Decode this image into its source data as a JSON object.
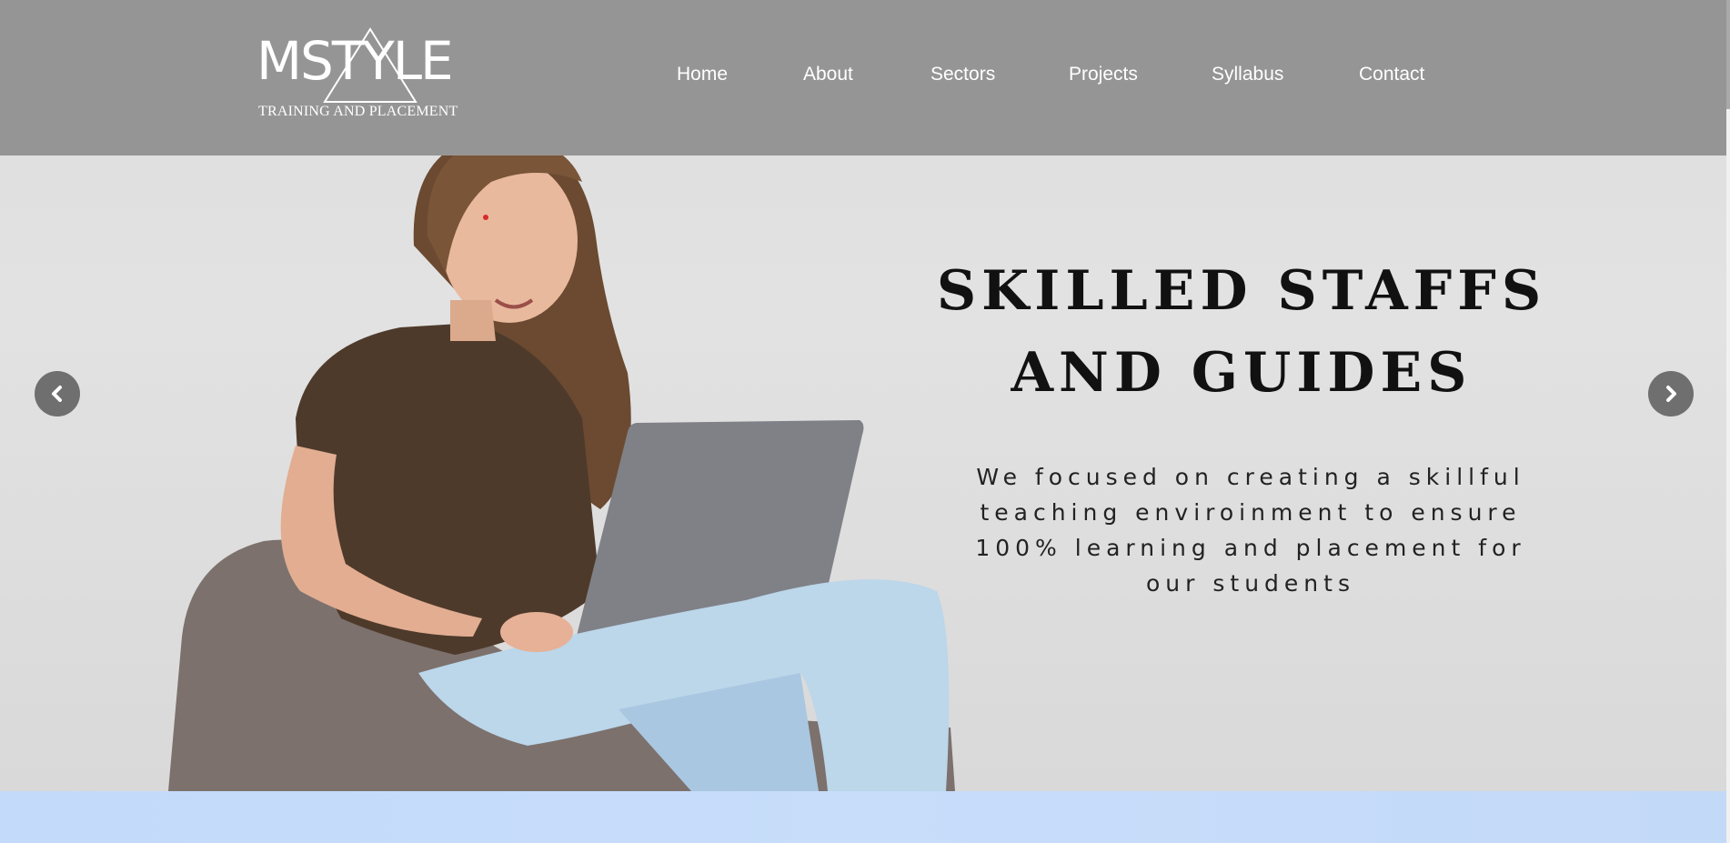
{
  "brand": {
    "name": "MSTYLE",
    "tagline": "TRAINING AND PLACEMENT"
  },
  "nav": {
    "items": [
      {
        "label": "Home"
      },
      {
        "label": "About"
      },
      {
        "label": "Sectors"
      },
      {
        "label": "Projects"
      },
      {
        "label": "Syllabus"
      },
      {
        "label": "Contact"
      }
    ]
  },
  "slide": {
    "headline_line1": "SKILLED STAFFS",
    "headline_line2": "AND GUIDES",
    "description": "We focused on creating a skillful teaching enviroinment to ensure 100% learning and placement for our students"
  },
  "controls": {
    "prev_icon": "chevron-left-icon",
    "next_icon": "chevron-right-icon"
  },
  "colors": {
    "header_bg": "#959595",
    "arrow_bg": "#6f6f6f",
    "bottom_band": "#c3dafa"
  }
}
